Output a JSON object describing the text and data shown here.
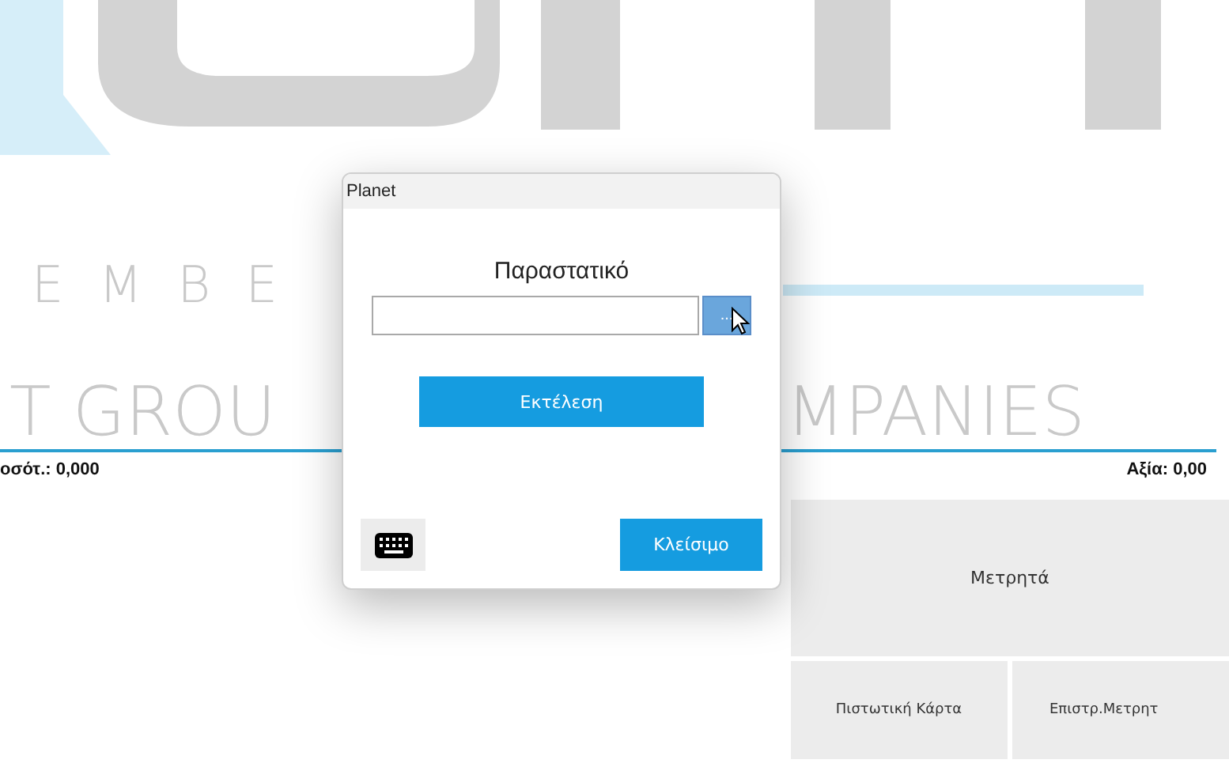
{
  "background_logo": {
    "lines": [
      "E M B E",
      "T GROU",
      "MPANIES"
    ]
  },
  "totals": {
    "quantity": "οσότ.: 0,000",
    "value": "Αξία: 0,00"
  },
  "payment_buttons": [
    {
      "label": "Μετρητά",
      "kind": "wide"
    },
    {
      "label": "Πιστωτική Κάρτα",
      "kind": "half"
    },
    {
      "label": "Επιστρ.Μετρητ",
      "kind": "half"
    }
  ],
  "dialog": {
    "title": "Planet",
    "field_label": "Παραστατικό",
    "browse_button": "...",
    "execute_button": "Εκτέλεση",
    "close_button": "Κλείσιμο"
  }
}
